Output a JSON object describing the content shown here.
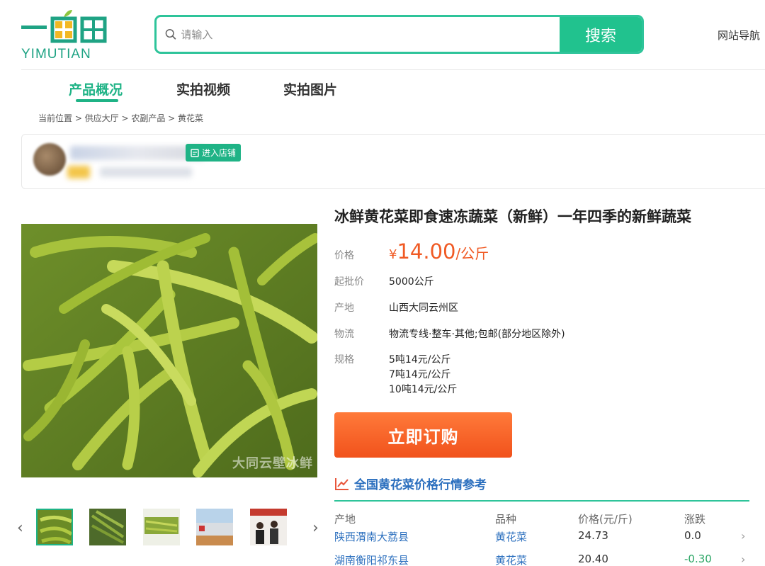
{
  "header": {
    "logo_text": "YIMUTIAN",
    "search_placeholder": "请输入",
    "search_button": "搜索",
    "site_nav": "网站导航"
  },
  "tabs": [
    {
      "label": "产品概况",
      "active": true
    },
    {
      "label": "实拍视频",
      "active": false
    },
    {
      "label": "实拍图片",
      "active": false
    }
  ],
  "breadcrumb": "当前位置 > 供应大厅 > 农副产品 > 黄花菜",
  "store": {
    "enter_button": "进入店铺"
  },
  "product": {
    "title": "冰鲜黄花菜即食速冻蔬菜（新鲜）一年四季的新鲜蔬菜",
    "price_label": "价格",
    "price_symbol": "¥",
    "price_value": "14.00",
    "price_unit": "/公斤",
    "moq_label": "起批价",
    "moq_value": "5000公斤",
    "origin_label": "产地",
    "origin_value": "山西大同云州区",
    "logistics_label": "物流",
    "logistics_value": "物流专线·整车·其他;包邮(部分地区除外)",
    "spec_label": "规格",
    "specs": [
      "5吨14元/公斤",
      "7吨14元/公斤",
      "10吨14元/公斤"
    ],
    "order_button": "立即订购",
    "image_watermark": "大同云壁冰鲜"
  },
  "market": {
    "title": "全国黄花菜价格行情参考",
    "columns": [
      "产地",
      "品种",
      "价格(元/斤)",
      "涨跌"
    ],
    "rows": [
      {
        "origin": "陕西渭南大荔县",
        "variety": "黄花菜",
        "price": "24.73",
        "change": "0.0"
      },
      {
        "origin": "湖南衡阳祁东县",
        "variety": "黄花菜",
        "price": "20.40",
        "change": "-0.30"
      }
    ]
  },
  "colors": {
    "brand_green": "#1fb386",
    "search_green": "#21c28e",
    "price_orange": "#f05a24",
    "link_blue": "#2b6fbe",
    "change_down_green": "#2aa564"
  }
}
